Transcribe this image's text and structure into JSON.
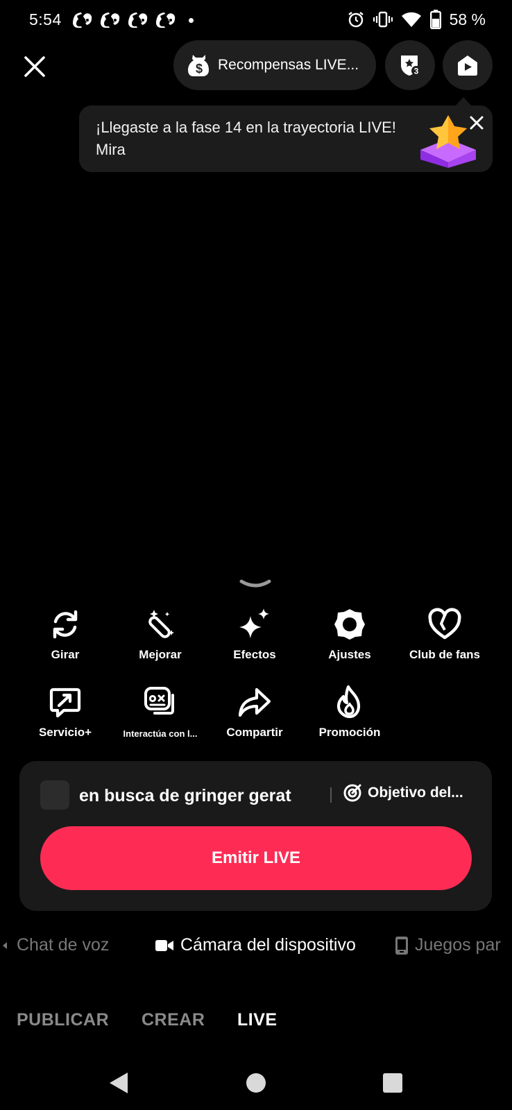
{
  "status_bar": {
    "time": "5:54",
    "battery_percent": "58 %",
    "notification_icons": [
      "discord-icon",
      "discord-icon",
      "discord-icon",
      "discord-icon"
    ],
    "system_icons": [
      "alarm-icon",
      "vibrate-icon",
      "wifi-icon",
      "battery-icon"
    ]
  },
  "header": {
    "rewards_label": "Recompensas LIVE...",
    "rank_badge_number": "3"
  },
  "banner": {
    "message": "¡Llegaste a la fase 14 en la trayectoria LIVE! Mira"
  },
  "tools": {
    "row1": [
      {
        "label": "Girar",
        "icon": "rotate-icon"
      },
      {
        "label": "Mejorar",
        "icon": "magic-wand-icon"
      },
      {
        "label": "Efectos",
        "icon": "sparkles-icon"
      },
      {
        "label": "Ajustes",
        "icon": "settings-icon"
      },
      {
        "label": "Club de fans",
        "icon": "heart-icon"
      }
    ],
    "row2": [
      {
        "label": "Servicio+",
        "icon": "service-icon"
      },
      {
        "label": "Interactúa con l...",
        "icon": "interact-icon"
      },
      {
        "label": "Compartir",
        "icon": "share-icon"
      },
      {
        "label": "Promoción",
        "icon": "flame-icon"
      }
    ]
  },
  "live_card": {
    "title": "en busca de gringer gerat",
    "goal_label": "Objetivo del...",
    "go_live_label": "Emitir LIVE"
  },
  "modes": [
    {
      "label": "Chat de voz"
    },
    {
      "label": "Cámara del dispositivo"
    },
    {
      "label": "Juegos par"
    }
  ],
  "bottom_tabs": [
    {
      "label": "PUBLICAR"
    },
    {
      "label": "CREAR"
    },
    {
      "label": "LIVE"
    }
  ],
  "colors": {
    "background": "#000000",
    "card": "#1a1a1a",
    "accent": "#fe2c55",
    "muted_text": "#8a8a8a"
  }
}
